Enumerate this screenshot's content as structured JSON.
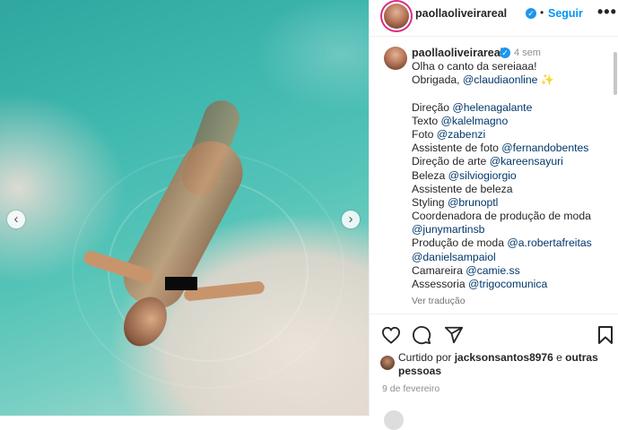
{
  "post": {
    "username": "paollaoliveirareal",
    "follow_label": "Seguir",
    "more_label": "•••",
    "time_ago": "4 sem",
    "caption_lines": [
      {
        "text": "Olha o canto da sereiaaa!"
      },
      {
        "prefix": "Obrigada, ",
        "mention": "@claudiaonline",
        "suffix": " ✨"
      },
      {
        "blank": true
      },
      {
        "prefix": "Direção ",
        "mention": "@helenagalante"
      },
      {
        "prefix": "Texto ",
        "mention": "@kalelmagno"
      },
      {
        "prefix": "Foto ",
        "mention": "@zabenzi"
      },
      {
        "prefix": "Assistente de foto ",
        "mention": "@fernandobentes"
      },
      {
        "prefix": "Direção de arte ",
        "mention": "@kareensayuri"
      },
      {
        "prefix": "Beleza ",
        "mention": "@silviogiorgio"
      },
      {
        "text": "Assistente de beleza"
      },
      {
        "prefix": "Styling ",
        "mention": "@brunoptl"
      },
      {
        "text": "Coordenadora de produção de moda"
      },
      {
        "mention": "@junymartinsb"
      },
      {
        "prefix": "Produção de moda ",
        "mention": "@a.robertafreitas"
      },
      {
        "mention": "@danielsampaiol"
      },
      {
        "prefix": "Camareira ",
        "mention": "@camie.ss"
      },
      {
        "prefix": "Assessoria ",
        "mention": "@trigocomunica"
      }
    ],
    "translate_label": "Ver tradução",
    "liked_by_prefix": "Curtido por ",
    "liked_by_user": "jacksonsantos8976",
    "liked_by_middle": " e ",
    "liked_by_others": "outras pessoas",
    "date": "9 de fevereiro"
  },
  "carousel": {
    "prev_label": "‹",
    "next_label": "›"
  },
  "icons": {
    "like": "heart-icon",
    "comment": "comment-icon",
    "share": "share-icon",
    "save": "bookmark-icon",
    "verified": "verified-icon"
  },
  "colors": {
    "link": "#00376b",
    "follow": "#0095f6",
    "verified": "#1c96f0",
    "text": "#262626"
  }
}
